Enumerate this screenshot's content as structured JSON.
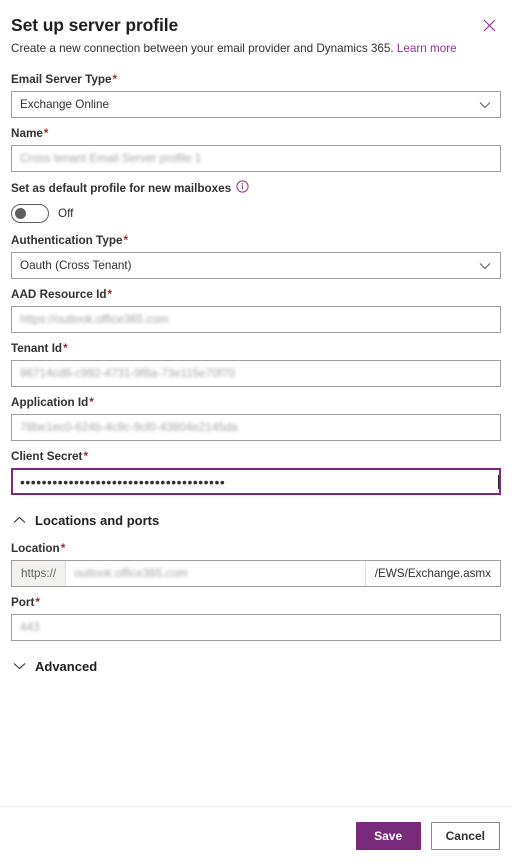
{
  "dialog": {
    "title": "Set up server profile",
    "subtitle_text": "Create a new connection between your email provider and Dynamics 365.",
    "learn_more_label": "Learn more",
    "close_icon": "close-icon"
  },
  "theme": {
    "accent": "#7a2a7a",
    "link": "#8c3a8c",
    "required_asterisk": "#a4262c",
    "border": "#a19f9d",
    "text": "#323130"
  },
  "fields": {
    "email_server_type": {
      "label": "Email Server Type",
      "required": "*",
      "value": "Exchange Online",
      "icon": "chevron-down-icon"
    },
    "name": {
      "label": "Name",
      "required": "*",
      "placeholder": "Cross tenant Email Server profile 1"
    },
    "default_profile": {
      "label": "Set as default profile for new mailboxes",
      "info_icon": "info-icon",
      "toggle_state": "Off"
    },
    "authentication_type": {
      "label": "Authentication Type",
      "required": "*",
      "value": "Oauth (Cross Tenant)",
      "icon": "chevron-down-icon"
    },
    "aad_resource_id": {
      "label": "AAD Resource Id",
      "required": "*",
      "placeholder": "https://outlook.office365.com"
    },
    "tenant_id": {
      "label": "Tenant Id",
      "required": "*",
      "placeholder": "96714cd6-c992-4731-9f8a-73e115e70f70"
    },
    "application_id": {
      "label": "Application Id",
      "required": "*",
      "placeholder": "78be1ec0-624b-4c9c-9cf0-43804e2145da"
    },
    "client_secret": {
      "label": "Client Secret",
      "required": "*",
      "value": "••••••••••••••••••••••••••••••••••••••"
    },
    "location": {
      "label": "Location",
      "required": "*",
      "prefix": "https://",
      "placeholder": "outlook.office365.com",
      "suffix": "/EWS/Exchange.asmx"
    },
    "port": {
      "label": "Port",
      "required": "*",
      "placeholder": "443"
    }
  },
  "sections": {
    "locations_and_ports": {
      "label": "Locations and ports",
      "expanded": "true",
      "icon": "chevron-up-icon"
    },
    "advanced": {
      "label": "Advanced",
      "expanded": "false",
      "icon": "chevron-down-icon"
    }
  },
  "footer": {
    "save_label": "Save",
    "cancel_label": "Cancel"
  }
}
